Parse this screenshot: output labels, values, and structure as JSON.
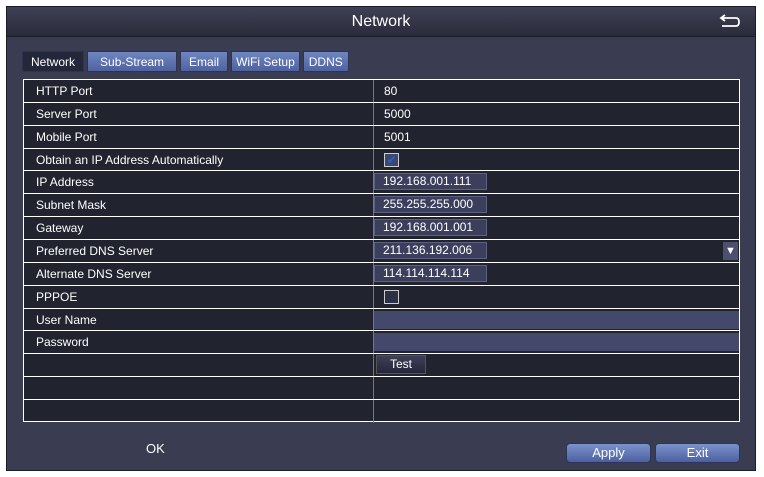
{
  "window": {
    "title": "Network",
    "back_icon": "return-arrow-icon"
  },
  "tabs": [
    {
      "label": "Network",
      "active": true
    },
    {
      "label": "Sub-Stream"
    },
    {
      "label": "Email"
    },
    {
      "label": "WiFi Setup"
    },
    {
      "label": "DDNS"
    }
  ],
  "rows": {
    "http_port": {
      "label": "HTTP Port",
      "value": "80"
    },
    "server_port": {
      "label": "Server Port",
      "value": "5000"
    },
    "mobile_port": {
      "label": "Mobile Port",
      "value": "5001"
    },
    "dhcp": {
      "label": "Obtain an IP Address Automatically",
      "checked": true
    },
    "ip": {
      "label": "IP Address",
      "value": "192.168.001.111"
    },
    "mask": {
      "label": "Subnet Mask",
      "value": "255.255.255.000"
    },
    "gateway": {
      "label": "Gateway",
      "value": "192.168.001.001"
    },
    "dns1": {
      "label": "Preferred DNS Server",
      "value": "211.136.192.006"
    },
    "dns2": {
      "label": "Alternate DNS Server",
      "value": "114.114.114.114"
    },
    "pppoe": {
      "label": "PPPOE",
      "checked": false
    },
    "username": {
      "label": "User Name",
      "value": ""
    },
    "password": {
      "label": "Password",
      "value": ""
    },
    "test_label": "Test"
  },
  "footer": {
    "ok": "OK",
    "apply": "Apply",
    "exit": "Exit"
  }
}
